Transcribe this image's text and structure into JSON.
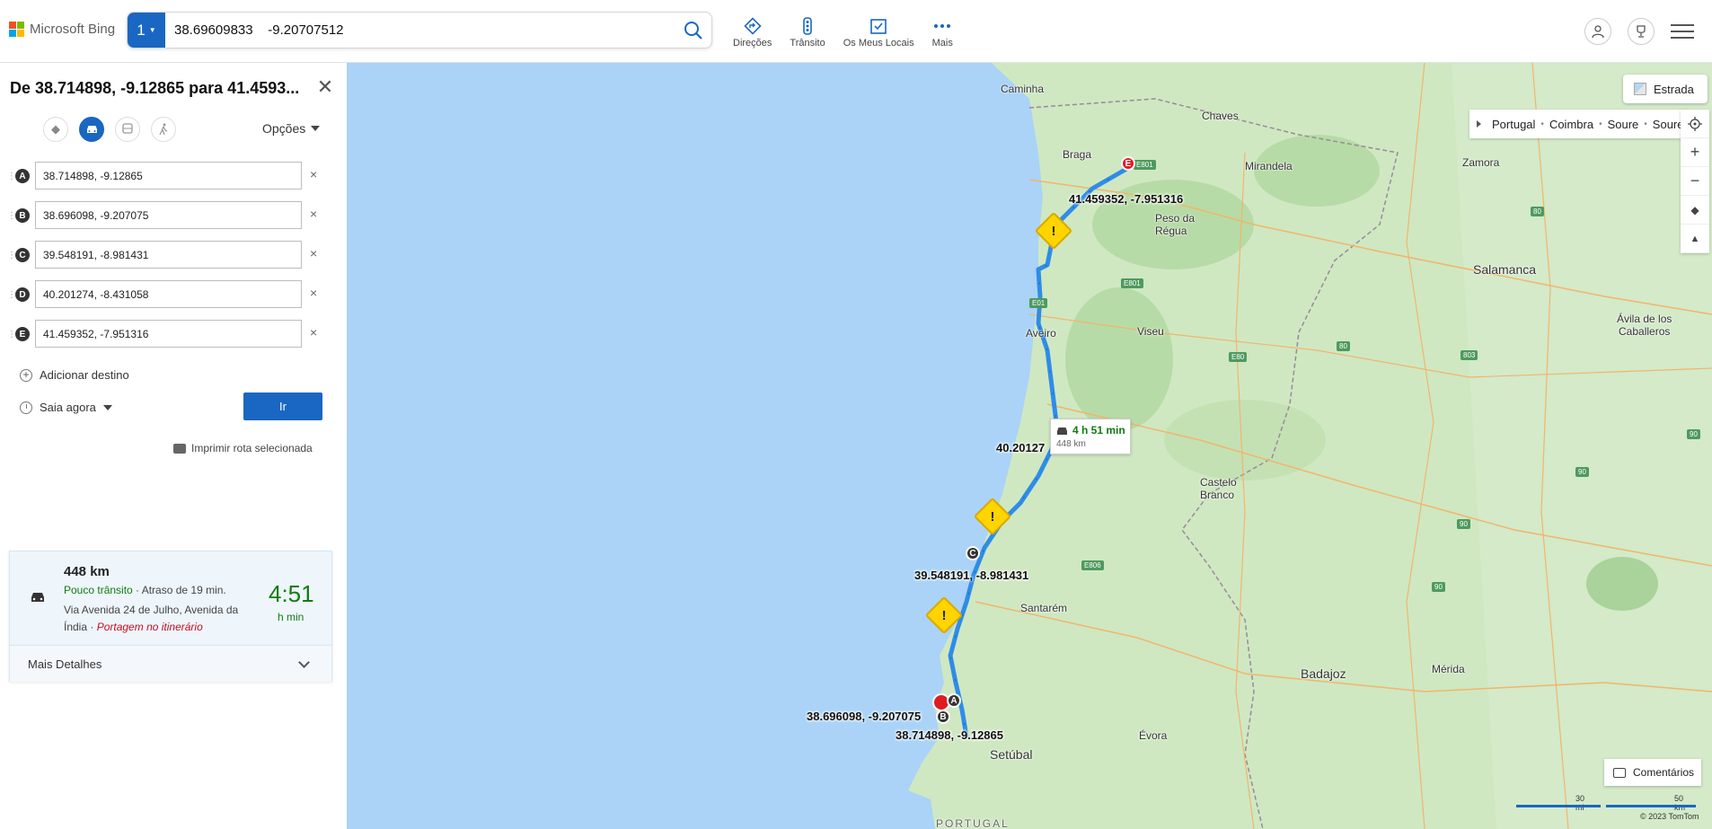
{
  "header": {
    "logo_text": "Microsoft Bing",
    "search_count": "1",
    "search_query": "38.69609833    -9.20707512",
    "nav": [
      {
        "label": "Direções",
        "icon": "directions-icon"
      },
      {
        "label": "Trânsito",
        "icon": "traffic-icon"
      },
      {
        "label": "Os Meus Locais",
        "icon": "my-places-icon"
      },
      {
        "label": "Mais",
        "icon": "more-icon"
      }
    ]
  },
  "panel": {
    "title": "De 38.714898, -9.12865 para 41.4593...",
    "options_label": "Opções",
    "waypoints": [
      {
        "letter": "A",
        "value": "38.714898, -9.12865"
      },
      {
        "letter": "B",
        "value": "38.696098, -9.207075"
      },
      {
        "letter": "C",
        "value": "39.548191, -8.981431"
      },
      {
        "letter": "D",
        "value": "40.201274, -8.431058"
      },
      {
        "letter": "E",
        "value": "41.459352, -7.951316"
      }
    ],
    "delete_glyph": "×",
    "add_destination": "Adicionar destino",
    "leave_now": "Saia agora",
    "go_label": "Ir",
    "print_label": "Imprimir rota selecionada"
  },
  "route_card": {
    "distance": "448 km",
    "traffic": "Pouco trânsito",
    "delay": " · Atraso de 19 min.",
    "via": "Via Avenida 24 de Julho, Avenida da Índia",
    "toll": "Portagem no itinerário",
    "time": "4:51",
    "time_unit": "h min",
    "more_details": "Mais Detalhes"
  },
  "map": {
    "style_label": "Estrada",
    "breadcrumb": [
      "Portugal",
      "Coimbra",
      "Soure",
      "Soure"
    ],
    "route_time": "4 h 51 min",
    "route_distance": "448 km",
    "feedback": "Comentários",
    "scale_mi": "30 mi",
    "scale_km": "50 km",
    "copyright": "© 2023 TomTom",
    "places": {
      "caminha": "Caminha",
      "chaves": "Chaves",
      "braga": "Braga",
      "mirandela": "Mirandela",
      "zamora": "Zamora",
      "peso": "Peso da",
      "regua": "Régua",
      "salamanca": "Salamanca",
      "aveiro": "Aveiro",
      "viseu": "Viseu",
      "avila": "Ávila de los",
      "caballeros": "Caballeros",
      "castelo": "Castelo",
      "branco": "Branco",
      "santarem": "Santarém",
      "badajoz": "Badajoz",
      "merida": "Mérida",
      "evora": "Évora",
      "setubal": "Setúbal",
      "portugal": "PORTUGAL"
    },
    "coords": {
      "E": "41.459352, -7.951316",
      "D": "40.20127",
      "C": "39.548191, -8.981431",
      "B": "38.696098, -9.207075",
      "A": "38.714898, -9.12865"
    },
    "roads": [
      "E801",
      "E801",
      "E01",
      "E80",
      "80",
      "803",
      "80",
      "90",
      "90",
      "90",
      "90",
      "E806"
    ],
    "colors": {
      "water": "#aad3f7",
      "land": "#cfe8c2",
      "route": "#2f8ce8",
      "brand": "#1967c2",
      "warning": "#ffd400"
    }
  }
}
